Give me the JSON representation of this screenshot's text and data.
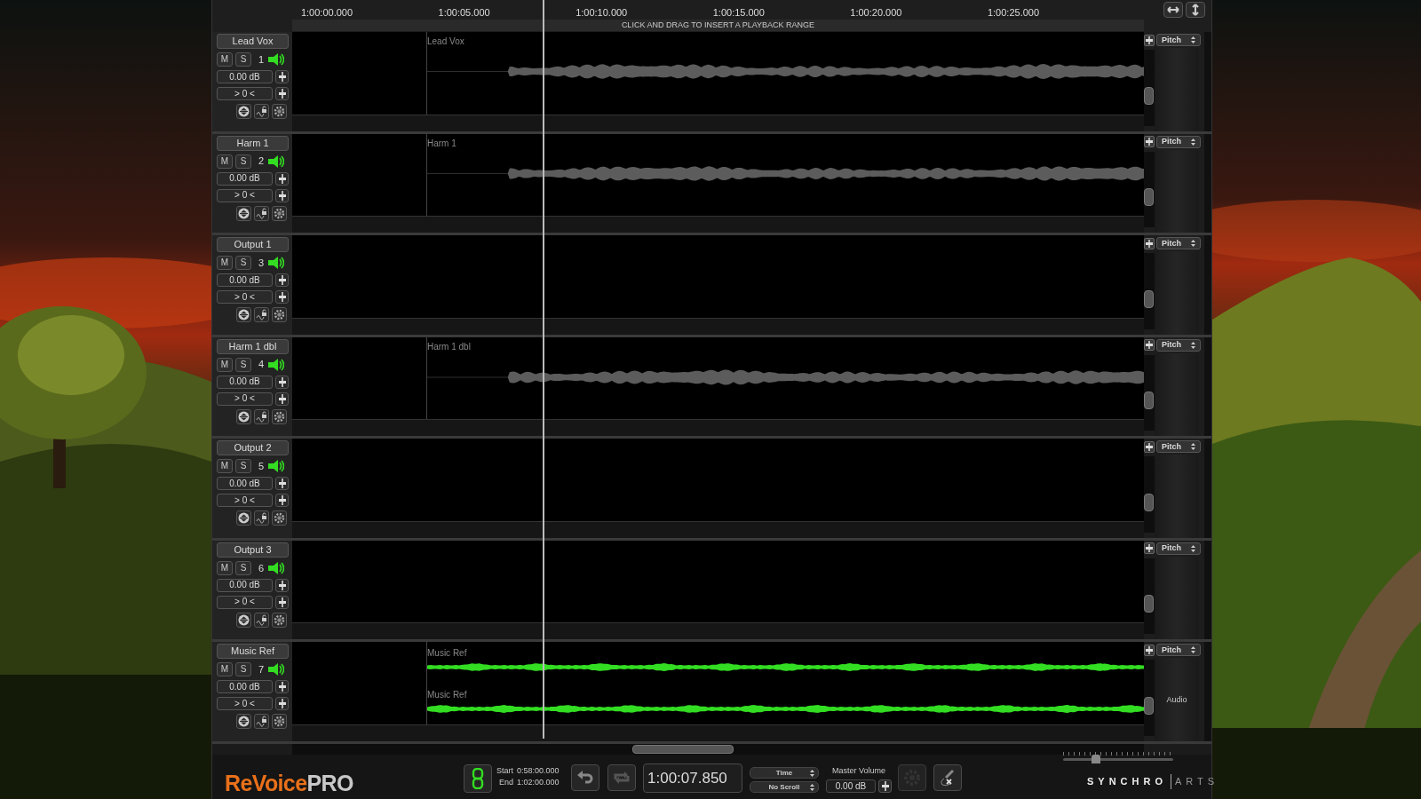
{
  "ruler": {
    "times": [
      "1:00:00.000",
      "1:00:05.000",
      "1:00:10.000",
      "1:00:15.000",
      "1:00:20.000",
      "1:00:25.000"
    ],
    "hint": "CLICK AND DRAG TO INSERT A PLAYBACK RANGE"
  },
  "tracks": [
    {
      "name": "Lead Vox",
      "mute_label": "M",
      "solo_label": "S",
      "number": "1",
      "muted": false,
      "soloed": false,
      "volume": "0.00 dB",
      "pan": "> 0 <",
      "dropdown": "Pitch",
      "clips": [
        {
          "label": "Lead Vox",
          "kind": "vocal",
          "color": "#5c5c5c"
        }
      ]
    },
    {
      "name": "Harm 1",
      "mute_label": "M",
      "solo_label": "S",
      "number": "2",
      "muted": false,
      "soloed": false,
      "volume": "0.00 dB",
      "pan": "> 0 <",
      "dropdown": "Pitch",
      "clips": [
        {
          "label": "Harm 1",
          "kind": "vocal",
          "color": "#5c5c5c"
        }
      ]
    },
    {
      "name": "Output 1",
      "mute_label": "M",
      "solo_label": "S",
      "number": "3",
      "muted": false,
      "soloed": false,
      "volume": "0.00 dB",
      "pan": "> 0 <",
      "dropdown": "Pitch"
    },
    {
      "name": "Harm 1 dbl",
      "mute_label": "M",
      "solo_label": "S",
      "number": "4",
      "muted": false,
      "soloed": false,
      "volume": "0.00 dB",
      "pan": "> 0 <",
      "dropdown": "Pitch",
      "clips": [
        {
          "label": "Harm 1 dbl",
          "kind": "vocal",
          "color": "#5c5c5c"
        }
      ]
    },
    {
      "name": "Output 2",
      "mute_label": "M",
      "solo_label": "S",
      "number": "5",
      "muted": false,
      "soloed": false,
      "volume": "0.00 dB",
      "pan": "> 0 <",
      "dropdown": "Pitch"
    },
    {
      "name": "Output 3",
      "mute_label": "M",
      "solo_label": "S",
      "number": "6",
      "muted": false,
      "soloed": false,
      "volume": "0.00 dB",
      "pan": "> 0 <",
      "dropdown": "Pitch"
    },
    {
      "name": "Music Ref",
      "mute_label": "M",
      "solo_label": "S",
      "number": "7",
      "muted": false,
      "soloed": false,
      "volume": "0.00 dB",
      "pan": "> 0 <",
      "dropdown": "Pitch",
      "side_label": "Audio",
      "clips": [
        {
          "label": "Music Ref",
          "kind": "music",
          "color": "#33dd22"
        },
        {
          "label": "Music Ref",
          "kind": "music",
          "color": "#33dd22"
        }
      ]
    }
  ],
  "logo": {
    "name": "ReVoice",
    "suffix": "PRO"
  },
  "transport": {
    "link_on": true,
    "start_label": "Start",
    "start": "0:58:00.000",
    "end_label": "End",
    "end": "1:02:00.000",
    "time": "1:00:07.850",
    "display_mode": "Time",
    "scroll_mode": "No Scroll",
    "master_volume_label": "Master Volume",
    "master_volume": "0.00 dB"
  },
  "zoom_slider": {
    "level": 0.3
  },
  "brand": {
    "left": "SYNCHRO",
    "right": "ARTS"
  }
}
